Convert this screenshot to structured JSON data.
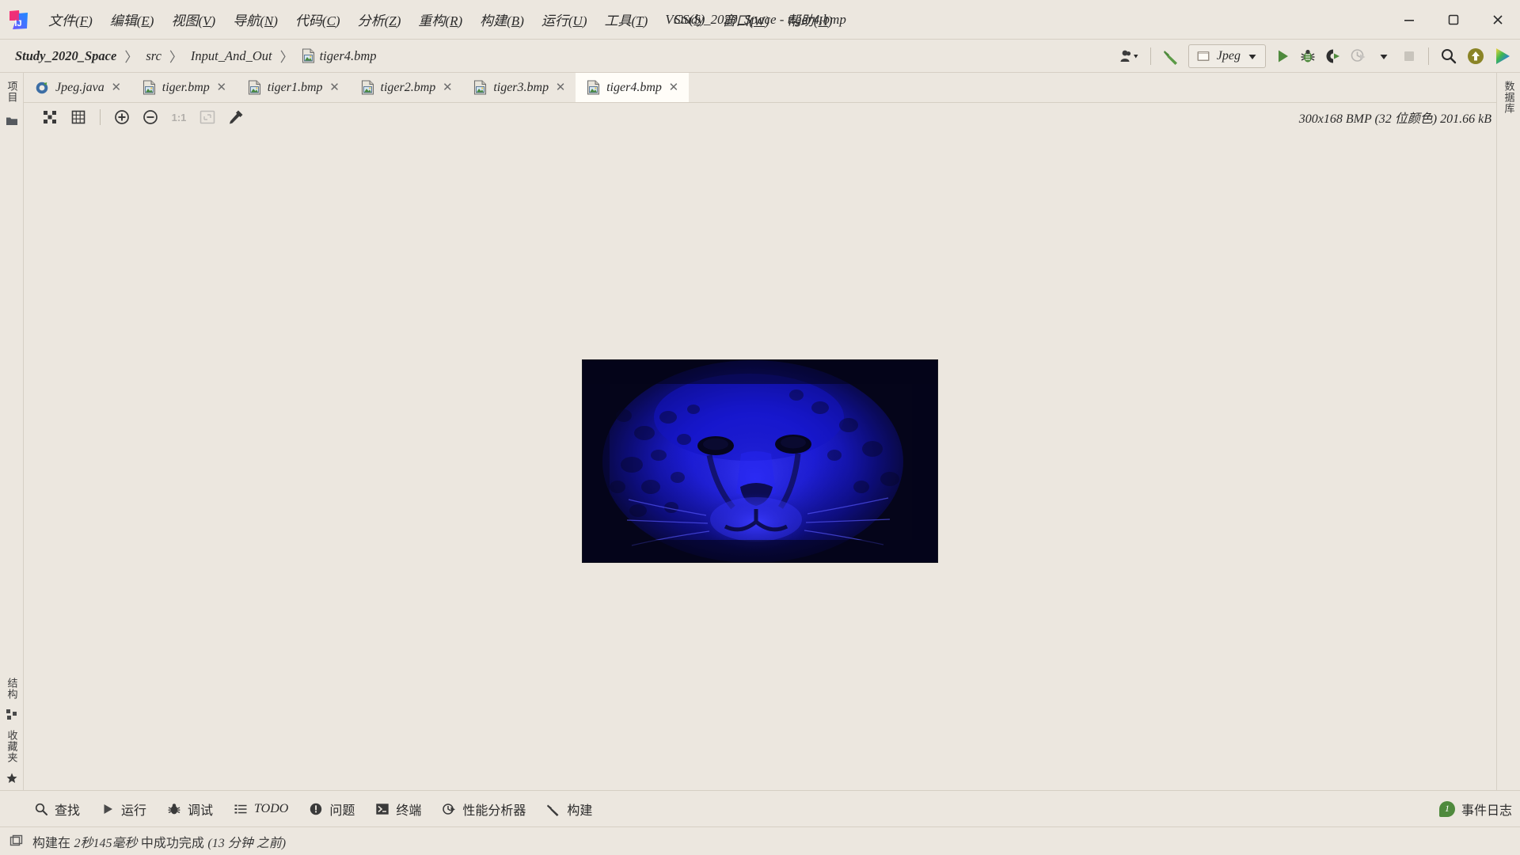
{
  "window": {
    "title": "Study_2020_Space - tiger4.bmp",
    "logo_name": "intellij-idea-logo",
    "controls": [
      {
        "name": "minimize-button",
        "glyph": "minimize-icon"
      },
      {
        "name": "maximize-button",
        "glyph": "maximize-icon"
      },
      {
        "name": "close-button",
        "glyph": "close-icon"
      }
    ]
  },
  "menubar": {
    "items": [
      {
        "label": "文件",
        "mnemonic": "F",
        "name": "menu-file"
      },
      {
        "label": "编辑",
        "mnemonic": "E",
        "name": "menu-edit"
      },
      {
        "label": "视图",
        "mnemonic": "V",
        "name": "menu-view"
      },
      {
        "label": "导航",
        "mnemonic": "N",
        "name": "menu-navigate"
      },
      {
        "label": "代码",
        "mnemonic": "C",
        "name": "menu-code"
      },
      {
        "label": "分析",
        "mnemonic": "Z",
        "name": "menu-analyze"
      },
      {
        "label": "重构",
        "mnemonic": "R",
        "name": "menu-refactor"
      },
      {
        "label": "构建",
        "mnemonic": "B",
        "name": "menu-build"
      },
      {
        "label": "运行",
        "mnemonic": "U",
        "name": "menu-run"
      },
      {
        "label": "工具",
        "mnemonic": "T",
        "name": "menu-tools"
      },
      {
        "label": "VCS",
        "mnemonic": "S",
        "name": "menu-vcs"
      },
      {
        "label": "窗口",
        "mnemonic": "W",
        "name": "menu-window"
      },
      {
        "label": "帮助",
        "mnemonic": "H",
        "name": "menu-help"
      }
    ]
  },
  "breadcrumb": {
    "separator": "〉",
    "items": [
      {
        "label": "Study_2020_Space",
        "name": "breadcrumb-project",
        "bold": true,
        "icon": null
      },
      {
        "label": "src",
        "name": "breadcrumb-src",
        "bold": false,
        "icon": null
      },
      {
        "label": "Input_And_Out",
        "name": "breadcrumb-package",
        "bold": false,
        "icon": null
      },
      {
        "label": "tiger4.bmp",
        "name": "breadcrumb-file",
        "bold": false,
        "icon": "image-file-icon"
      }
    ]
  },
  "toolbar": {
    "account_button": {
      "name": "account-button",
      "icon": "user-icon"
    },
    "build_button": {
      "name": "build-hammer-button",
      "icon": "hammer-icon"
    },
    "run_config": {
      "label": "Jpeg",
      "name": "run-configuration-selector",
      "icon": "run-config-icon",
      "chevron": "chevron-down-icon"
    },
    "buttons": [
      {
        "name": "run-button",
        "icon": "play-icon",
        "enabled": true
      },
      {
        "name": "debug-button",
        "icon": "bug-icon",
        "enabled": true
      },
      {
        "name": "run-with-coverage-button",
        "icon": "coverage-icon",
        "enabled": true
      },
      {
        "name": "profile-button",
        "icon": "profiler-clock-icon",
        "enabled": false
      },
      {
        "name": "profile-dropdown",
        "icon": "chevron-down-icon",
        "enabled": true
      },
      {
        "name": "stop-button",
        "icon": "stop-square-icon",
        "enabled": false
      },
      {
        "name": "search-everywhere-button",
        "icon": "search-icon",
        "enabled": true
      },
      {
        "name": "update-project-button",
        "icon": "update-arrow-up-icon",
        "enabled": true
      },
      {
        "name": "ide-feature-button",
        "icon": "colorful-play-icon",
        "enabled": true
      }
    ]
  },
  "left_rail": {
    "top": [
      {
        "label": "项目",
        "name": "tool-window-project"
      }
    ],
    "top_icons": [
      {
        "name": "project-files-icon"
      }
    ],
    "bottom": [
      {
        "label": "结构",
        "name": "tool-window-structure"
      },
      {
        "label": "收藏夹",
        "name": "tool-window-favorites"
      }
    ]
  },
  "right_rail": {
    "items": [
      {
        "label": "数据库",
        "name": "tool-window-database"
      }
    ]
  },
  "tabs": [
    {
      "label": "Jpeg.java",
      "name": "editor-tab-jpeg-java",
      "icon": "java-class-icon",
      "active": false,
      "close": "✕"
    },
    {
      "label": "tiger.bmp",
      "name": "editor-tab-tiger-bmp",
      "icon": "image-file-icon",
      "active": false,
      "close": "✕"
    },
    {
      "label": "tiger1.bmp",
      "name": "editor-tab-tiger1-bmp",
      "icon": "image-file-icon",
      "active": false,
      "close": "✕"
    },
    {
      "label": "tiger2.bmp",
      "name": "editor-tab-tiger2-bmp",
      "icon": "image-file-icon",
      "active": false,
      "close": "✕"
    },
    {
      "label": "tiger3.bmp",
      "name": "editor-tab-tiger3-bmp",
      "icon": "image-file-icon",
      "active": false,
      "close": "✕"
    },
    {
      "label": "tiger4.bmp",
      "name": "editor-tab-tiger4-bmp",
      "icon": "image-file-icon",
      "active": true,
      "close": "✕"
    }
  ],
  "image_editor": {
    "toolbar": [
      {
        "name": "toggle-transparency-chessboard-button",
        "icon": "checkerboard-icon",
        "enabled": true
      },
      {
        "name": "toggle-grid-button",
        "icon": "grid-icon",
        "enabled": true
      },
      {
        "name": "zoom-in-button",
        "icon": "zoom-in-icon",
        "enabled": true
      },
      {
        "name": "zoom-out-button",
        "icon": "zoom-out-icon",
        "enabled": true
      },
      {
        "name": "actual-size-button",
        "icon": "one-to-one-icon",
        "label": "1:1",
        "enabled": false
      },
      {
        "name": "fit-to-window-button",
        "icon": "fit-window-icon",
        "enabled": false
      },
      {
        "name": "color-picker-button",
        "icon": "eyedropper-icon",
        "enabled": true
      }
    ],
    "info": "300x168  BMP  (32 位颜色)  201.66 kB",
    "file_name": "tiger4.bmp",
    "dimensions": "300x168",
    "format": "BMP",
    "color_depth": "32 位颜色",
    "file_size": "201.66 kB",
    "image_alt": "dark-blue-tinted-leopard-face-photo"
  },
  "bottom_bar": {
    "items": [
      {
        "label": "查找",
        "name": "tool-window-find",
        "icon": "search-icon",
        "italic": false
      },
      {
        "label": "运行",
        "name": "tool-window-run",
        "icon": "play-icon",
        "italic": false
      },
      {
        "label": "调试",
        "name": "tool-window-debug",
        "icon": "bug-icon",
        "italic": false
      },
      {
        "label": "TODO",
        "name": "tool-window-todo",
        "icon": "list-icon",
        "italic": true
      },
      {
        "label": "问题",
        "name": "tool-window-problems",
        "icon": "exclamation-circle-icon",
        "italic": false
      },
      {
        "label": "终端",
        "name": "tool-window-terminal",
        "icon": "terminal-icon",
        "italic": false
      },
      {
        "label": "性能分析器",
        "name": "tool-window-profiler",
        "icon": "profiler-clock-icon",
        "italic": false
      },
      {
        "label": "构建",
        "name": "tool-window-build",
        "icon": "hammer-icon",
        "italic": false
      }
    ],
    "event_log": {
      "label": "事件日志",
      "name": "event-log-button",
      "badge": "1"
    }
  },
  "statusbar": {
    "icon": "status-window-icon",
    "text_parts": [
      "构建在 ",
      "2秒145毫秒",
      " 中成功完成 ",
      "(13 分钟 之前)"
    ],
    "text": "构建在 2秒145毫秒 中成功完成 (13 分钟 之前)"
  },
  "colors": {
    "background": "#ece7df",
    "tab_active": "#fffdf8",
    "border": "#d6cfc4",
    "accent_green": "#4f8a3d",
    "text": "#2b2b2b",
    "image_blue": "#1a1ae0",
    "image_dark": "#07071e"
  }
}
